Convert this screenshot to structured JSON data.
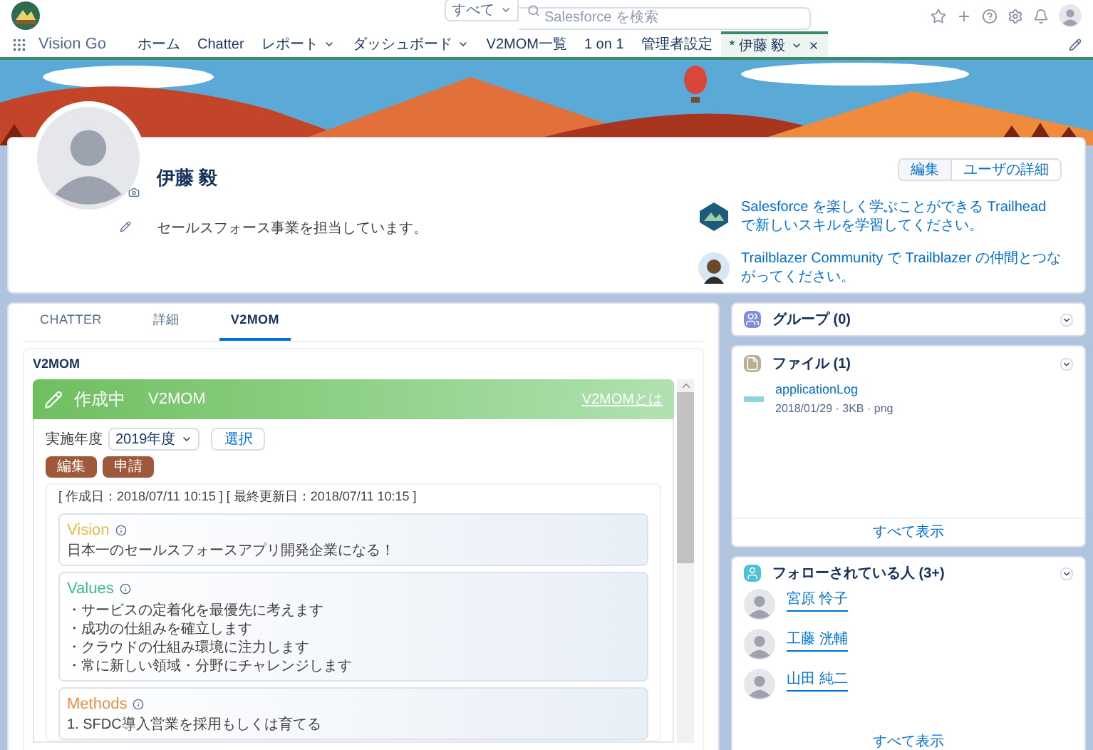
{
  "header": {
    "search_scope": "すべて",
    "search": {
      "placeholder": "Salesforce を検索"
    }
  },
  "nav": {
    "app_name": "Vision Go",
    "items": [
      {
        "label": "ホーム",
        "menu": false,
        "selected": false,
        "closable": false
      },
      {
        "label": "Chatter",
        "menu": false,
        "selected": false,
        "closable": false
      },
      {
        "label": "レポート",
        "menu": true,
        "selected": false,
        "closable": false
      },
      {
        "label": "ダッシュボード",
        "menu": true,
        "selected": false,
        "closable": false
      },
      {
        "label": "V2MOM一覧",
        "menu": false,
        "selected": false,
        "closable": false
      },
      {
        "label": "1 on 1",
        "menu": false,
        "selected": false,
        "closable": false
      },
      {
        "label": "管理者設定",
        "menu": false,
        "selected": false,
        "closable": false
      },
      {
        "label": "* 伊藤 毅",
        "menu": true,
        "selected": true,
        "closable": true
      }
    ]
  },
  "profile": {
    "name": "伊藤 毅",
    "buttons": [
      "編集",
      "ユーザの詳細"
    ],
    "description": "セールスフォース事業を担当しています。",
    "links": [
      {
        "kind": "trailhead",
        "text": "Salesforce を楽しく学ぶことができる Trailhead で新しいスキルを学習してください。"
      },
      {
        "kind": "community",
        "text": "Trailblazer Community で Trailblazer の仲間とつながってください。"
      }
    ]
  },
  "tabs": [
    {
      "label": "CHATTER",
      "selected": false
    },
    {
      "label": "詳細",
      "selected": false
    },
    {
      "label": "V2MOM",
      "selected": true
    }
  ],
  "v2mom": {
    "title": "V2MOM",
    "status": "作成中",
    "heading": "V2MOM",
    "help_link": "V2MOMとは",
    "year_label": "実施年度",
    "year": "2019年度",
    "select_button": "選択",
    "actions": [
      "編集",
      "申請"
    ],
    "dates": "[ 作成日：2018/07/11 10:15 ] [ 最終更新日：2018/07/11 10:15 ]",
    "sections": [
      {
        "title": "Vision",
        "color": "#e8b84a",
        "lines": [
          "日本一のセールスフォースアプリ開発企業になる！"
        ]
      },
      {
        "title": "Values",
        "color": "#3cbf8a",
        "lines": [
          "・サービスの定着化を最優先に考えます",
          "・成功の仕組みを確立します",
          "・クラウドの仕組み環境に注力します",
          "・常に新しい領域・分野にチャレンジします"
        ]
      },
      {
        "title": "Methods",
        "color": "#e8904a",
        "lines": [
          "1. SFDC導入営業を採用もしくは育てる"
        ]
      }
    ]
  },
  "groups": {
    "title": "グループ (0)"
  },
  "files": {
    "title": "ファイル (1)",
    "items": [
      {
        "name": "applicationLog",
        "meta": "2018/01/29 · 3KB · png"
      }
    ],
    "footer": "すべて表示"
  },
  "followers": {
    "title": "フォローされている人 (3+)",
    "people": [
      "宮原 怜子",
      "工藤 洸輔",
      "山田 純二"
    ],
    "footer": "すべて表示"
  }
}
